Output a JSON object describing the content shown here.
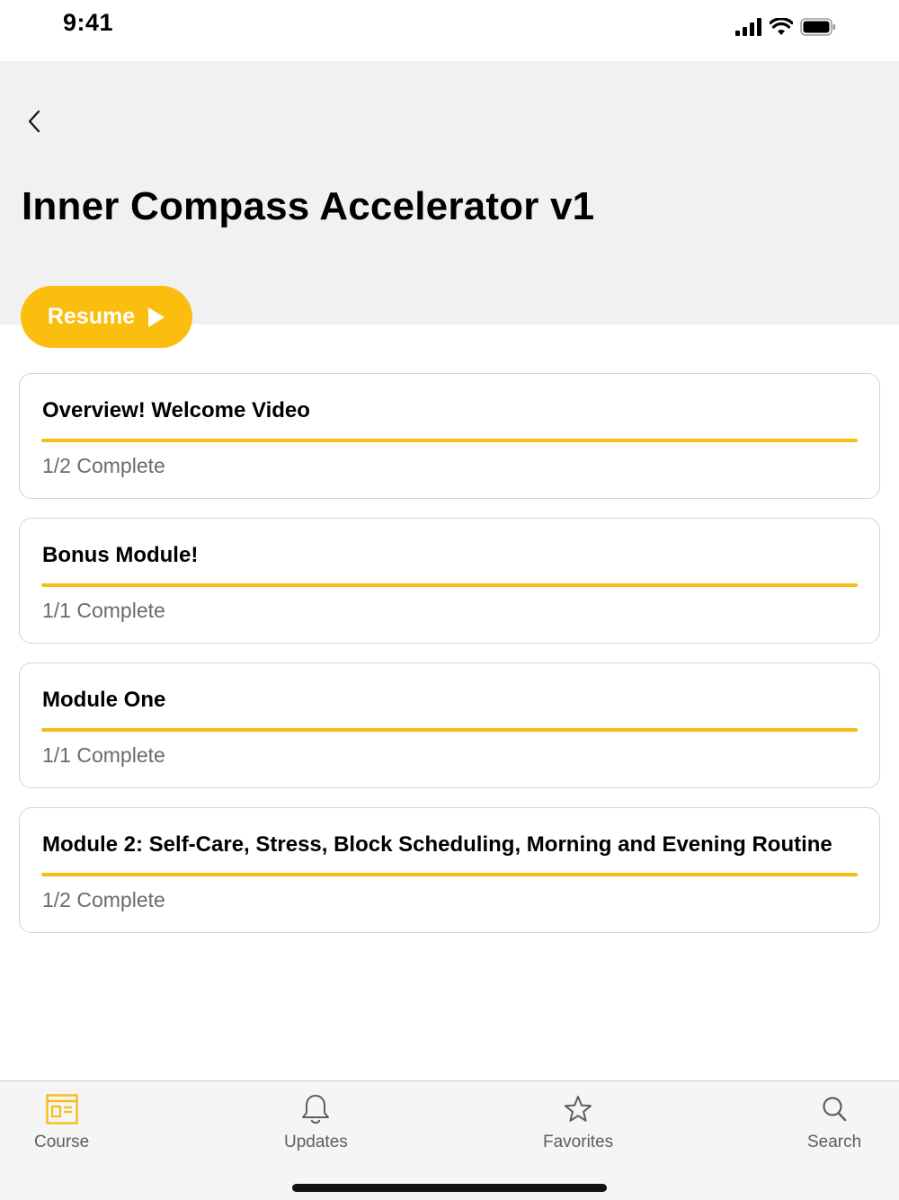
{
  "status_bar": {
    "time": "9:41"
  },
  "header": {
    "title": "Inner Compass Accelerator v1"
  },
  "resume_button": {
    "label": "Resume"
  },
  "colors": {
    "accent": "#fbbe0e",
    "header_bg": "#f1f1f1",
    "status_text": "#6b6b6b"
  },
  "modules": [
    {
      "title": "Overview! Welcome Video",
      "status": "1/2 Complete",
      "progress": 1.0
    },
    {
      "title": "Bonus Module!",
      "status": "1/1 Complete",
      "progress": 1.0
    },
    {
      "title": "Module One",
      "status": "1/1 Complete",
      "progress": 1.0
    },
    {
      "title": "Module 2: Self-Care, Stress, Block Scheduling, Morning and Evening Routine",
      "status": "1/2 Complete",
      "progress": 1.0
    }
  ],
  "tabs": [
    {
      "label": "Course",
      "icon": "course-icon",
      "active": true
    },
    {
      "label": "Updates",
      "icon": "bell-icon",
      "active": false
    },
    {
      "label": "Favorites",
      "icon": "star-icon",
      "active": false
    },
    {
      "label": "Search",
      "icon": "search-icon",
      "active": false
    }
  ]
}
